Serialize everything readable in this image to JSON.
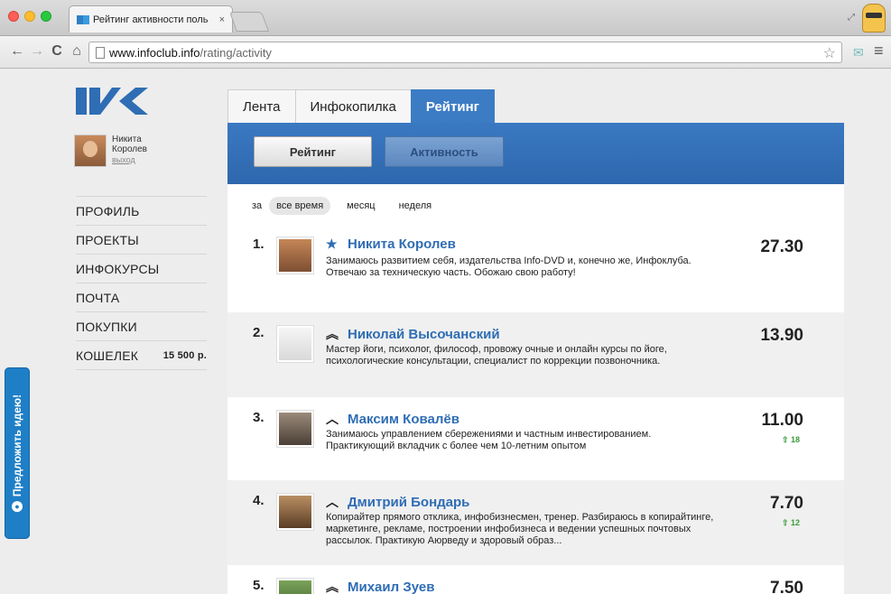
{
  "browser": {
    "tab_title": "Рейтинг активности поль",
    "tab_close": "×",
    "url_host": "www.infoclub.info",
    "url_path": "/rating/activity"
  },
  "user": {
    "first_name": "Никита",
    "last_name": "Королев",
    "logout": "выход"
  },
  "sidebar": {
    "items": [
      {
        "label": "ПРОФИЛЬ"
      },
      {
        "label": "ПРОЕКТЫ"
      },
      {
        "label": "ИНФОКУРСЫ"
      },
      {
        "label": "ПОЧТА"
      },
      {
        "label": "ПОКУПКИ"
      },
      {
        "label": "КОШЕЛЕК",
        "balance": "15 500 р."
      }
    ]
  },
  "idea_button": "Предложить идею!",
  "tabs": [
    "Лента",
    "Инфокопилка",
    "Рейтинг"
  ],
  "subnav": {
    "rating": "Рейтинг",
    "activity": "Активность"
  },
  "filter": {
    "label": "за",
    "options": [
      "все время",
      "месяц",
      "неделя"
    ]
  },
  "rows": [
    {
      "rank": "1.",
      "name": "Никита Королев",
      "icon": "star-icon",
      "desc": "Занимаюсь развитием себя, издательства Info-DVD и, конечно же, Инфоклуба. Отвечаю за техническую часть. Обожаю свою работу!",
      "score": "27.30",
      "delta": ""
    },
    {
      "rank": "2.",
      "name": "Николай Высочанский",
      "icon": "double-chevron-up-icon",
      "desc": "Мастер йоги, психолог, философ, провожу очные и онлайн курсы по йоге, психологические консультации, специалист по коррекции позвоночника.",
      "score": "13.90",
      "delta": ""
    },
    {
      "rank": "3.",
      "name": "Максим Ковалёв",
      "icon": "chevron-up-icon",
      "desc": "Занимаюсь управлением сбережениями и частным инвестированием. Практикующий вкладчик с более чем 10-летним опытом",
      "score": "11.00",
      "delta": "⇧ 18"
    },
    {
      "rank": "4.",
      "name": "Дмитрий Бондарь",
      "icon": "chevron-up-icon",
      "desc": "Копирайтер прямого отклика, инфобизнесмен, тренер. Разбираюсь в копирайтинге, маркетинге, рекламе, построении инфобизнеса и ведении успешных почтовых рассылок. Практикую Аюрведу и здоровый образ...",
      "score": "7.70",
      "delta": "⇧ 12"
    },
    {
      "rank": "5.",
      "name": "Михаил Зуев",
      "icon": "double-chevron-up-icon",
      "desc": "",
      "score": "7.50",
      "delta": ""
    }
  ]
}
